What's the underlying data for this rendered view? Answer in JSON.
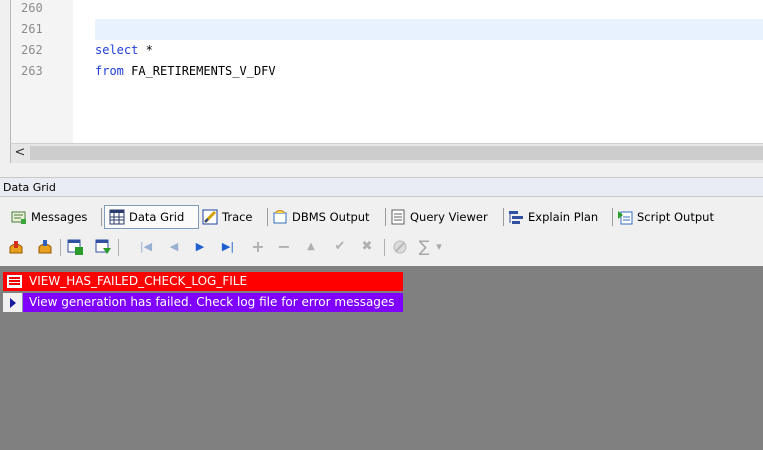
{
  "editor": {
    "line_numbers": [
      "260",
      "261",
      "262",
      "263"
    ],
    "lines": [
      {
        "keyword": "",
        "text": ""
      },
      {
        "keyword": "",
        "text": ""
      },
      {
        "keyword": "select",
        "text": " *"
      },
      {
        "keyword": "from",
        "text": " FA_RETIREMENTS_V_DFV"
      }
    ],
    "scroll_left_arrow": "<"
  },
  "panel": {
    "title": "Data Grid"
  },
  "tabs": [
    {
      "label": "Messages",
      "icon": "messages-icon"
    },
    {
      "label": "Data Grid",
      "icon": "data-grid-icon",
      "active": true
    },
    {
      "label": "Trace",
      "icon": "trace-icon"
    },
    {
      "label": "DBMS Output",
      "icon": "dbms-output-icon"
    },
    {
      "label": "Query Viewer",
      "icon": "query-viewer-icon"
    },
    {
      "label": "Explain Plan",
      "icon": "explain-plan-icon"
    },
    {
      "label": "Script Output",
      "icon": "script-output-icon"
    }
  ],
  "toolbar": {
    "icons": [
      "export-icon",
      "import-icon",
      "copy-grid-icon",
      "refresh-grid-icon",
      "first-record-icon",
      "prior-record-icon",
      "next-record-icon",
      "last-record-icon",
      "insert-record-icon",
      "delete-record-icon",
      "edit-record-icon",
      "post-edit-icon",
      "cancel-edit-icon",
      "clear-icon",
      "sum-icon",
      "dropdown-icon"
    ],
    "glyphs": {
      "first": "|◀",
      "prior": "◀",
      "next": "▶",
      "last": "▶|",
      "insert": "+",
      "delete": "−",
      "edit": "▲",
      "post": "✔",
      "cancel": "✖",
      "sum": "∑",
      "dropdown": "▾"
    }
  },
  "grid": {
    "column_header": "VIEW_HAS_FAILED_CHECK_LOG_FILE",
    "rows": [
      "View generation has failed. Check log file for error messages"
    ],
    "colors": {
      "header_bg": "#ff0000",
      "row_bg": "#8000ff",
      "area_bg": "#808080"
    }
  }
}
